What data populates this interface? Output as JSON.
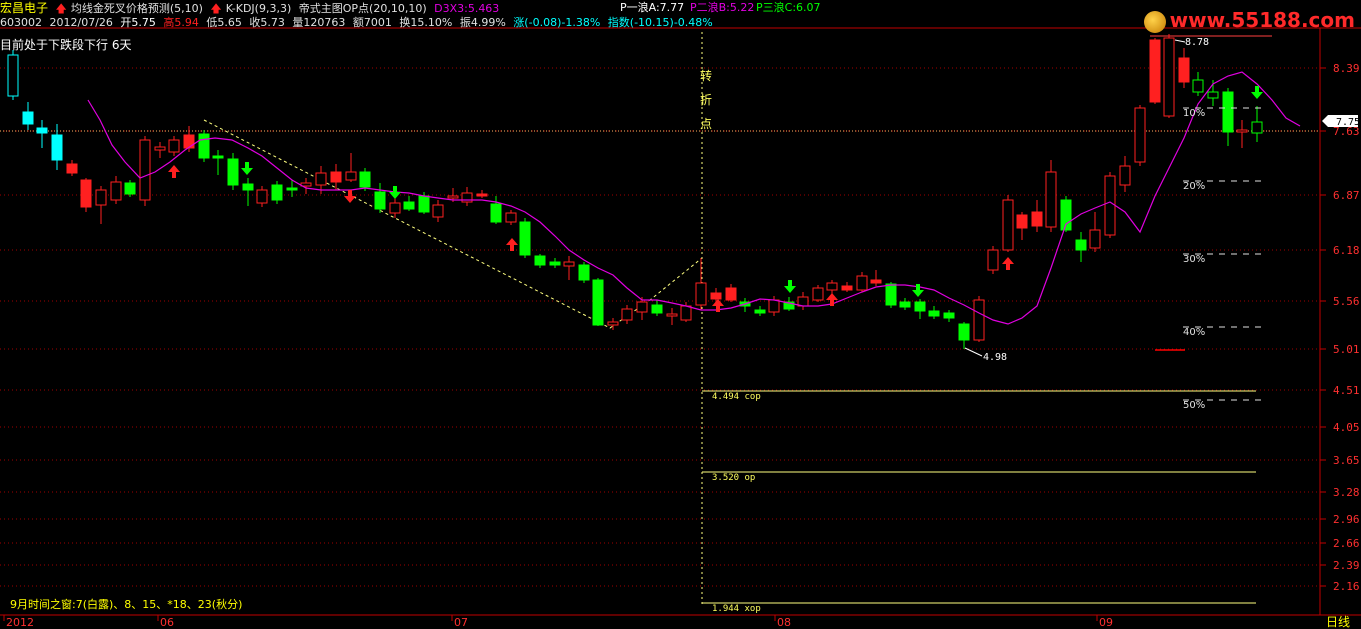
{
  "header": {
    "stock_name": "宏昌电子",
    "indicator1": "均线金死叉价格预测(5,10)",
    "indicator2": "K-KDJ(9,3,3)",
    "indicator3": "帝式主图OP点(20,10,10)",
    "d3x3": "D3X3:5.463",
    "wave_a": "P一浪A:7.77",
    "wave_b": "P二浪B:5.22",
    "wave_c": "P三浪C:6.07",
    "code": "603002",
    "date": "2012/07/26",
    "open": "开5.75",
    "high": "高5.94",
    "low": "低5.65",
    "close": "收5.73",
    "volume": "量120763",
    "amount": "额7001",
    "turnover": "换15.10%",
    "amplitude": "振4.99%",
    "change": "涨(-0.08)-1.38%",
    "index": "指数(-10.15)-0.48%"
  },
  "watermark": "www.55188.com",
  "trend_label": "目前处于下跌",
  "trend_suffix": "段下行 6天",
  "turn_point": [
    "转",
    "折",
    "点"
  ],
  "time_window": "9月时间之窗:7(白露)、8、15、*18、23(秋分)",
  "period_label": "日线",
  "x_labels": [
    "2012",
    "06",
    "07",
    "08",
    "09"
  ],
  "price_axis": [
    "8.39",
    "7.63",
    "6.87",
    "6.18",
    "5.56",
    "5.01",
    "4.51",
    "4.05",
    "3.65",
    "3.28",
    "2.96",
    "2.66",
    "2.39",
    "2.16"
  ],
  "current_price": "7.75",
  "peak_label": "8.78",
  "low_label": "4.98",
  "op_lines": [
    "4.494  cop",
    "3.520   op",
    "1.944  xop"
  ],
  "fib_labels": [
    "10%",
    "20%",
    "30%",
    "40%",
    "50%"
  ],
  "colors": {
    "up": "#ff2020",
    "down": "#00ff00",
    "ma": "#e000e0",
    "grid": "#a00000",
    "axis": "#c00000",
    "yellow": "#ffff00",
    "cyan": "#00ffff"
  }
}
